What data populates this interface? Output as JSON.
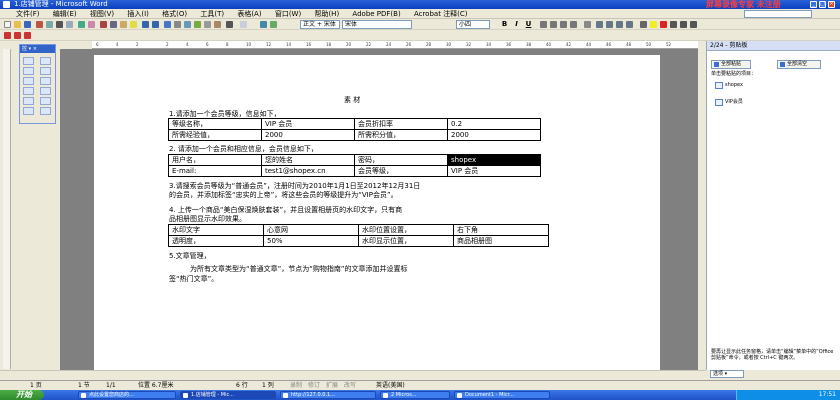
{
  "window": {
    "title": "1.店铺管理 - Microsoft Word",
    "watermark": "屏幕录像专家 未注册"
  },
  "menu": [
    "文件(F)",
    "编辑(E)",
    "视图(V)",
    "插入(I)",
    "格式(O)",
    "工具(T)",
    "表格(A)",
    "窗口(W)",
    "帮助(H)",
    "Adobe PDF(B)",
    "Acrobat 注释(C)"
  ],
  "toolbar": {
    "style": "正文 + 宋体",
    "font": "宋体",
    "size": "小四",
    "bold": "B",
    "italic": "I",
    "underline": "U"
  },
  "ruler_ticks": [
    "6",
    "4",
    "2",
    "2",
    "4",
    "6",
    "8",
    "10",
    "12",
    "14",
    "16",
    "18",
    "20",
    "22",
    "24",
    "26",
    "28",
    "30",
    "32",
    "34",
    "36",
    "38",
    "40",
    "42",
    "44",
    "46",
    "48",
    "50",
    "52"
  ],
  "palette": {
    "title": "控 ▾ ×"
  },
  "doc": {
    "title": "素 材",
    "item1": "1.请添加一个会员等级，信息如下，",
    "table1": [
      [
        "等级名称，",
        "VIP 会员",
        "会员折扣率",
        "0.2"
      ],
      [
        "所需经验值，",
        "2000",
        "所需积分值，",
        "2000"
      ]
    ],
    "item2": "2. 请添加一个会员和相应信息，会员信息如下，",
    "table2": [
      [
        "用户名，",
        "您的姓名",
        "密码，",
        "shopex"
      ],
      [
        "E-mail:",
        "test1@shopex.cn",
        "会员等级，",
        "VIP 会员"
      ]
    ],
    "item3a": "3.请搜索会员等级为“普通会员”，注册时间为2010年1月1日至2012年12月31日",
    "item3b": "的会员，并添加标签“忠实的上帝”，将这些会员的等级提升为“VIP会员”。",
    "item4a": "4. 上传一个商品“美白保湿焕肤套装”，并且设置相册页的水印文字，只有商",
    "item4b": "品相册图显示水印效果。",
    "table3": [
      [
        "水印文字",
        "心意网",
        "水印位置设置，",
        "右下角"
      ],
      [
        "透明度，",
        "50%",
        "水印显示位置，",
        "商品相册图"
      ]
    ],
    "item5": "5.文章管理，",
    "item5a": "为所有文章类型为“普通文章”，节点为“购物指南”的文章添加并设置标",
    "item5b": "签“热门文章”。"
  },
  "taskpane": {
    "header": "2/24 - 剪贴板",
    "paste_all": "全部粘贴",
    "clear_all": "全部清空",
    "hint": "单击要粘贴的项目：",
    "items": [
      "shopex",
      "VIP会员"
    ],
    "footer": "要再让显示此任务窗格，请单击“编辑”菜单中的“Office 剪贴板”命令，或者按 Ctrl+C 键两次。",
    "options": "选项 ▾"
  },
  "status": {
    "page": "1 页",
    "section": "1 节",
    "pages": "1/1",
    "position": "位置 6.7厘米",
    "line": "6 行",
    "column": "1 列",
    "rec": "录制",
    "trk": "修订",
    "ext": "扩展",
    "ovr": "改写",
    "lang": "英语(美国)"
  },
  "taskbar": {
    "start": "开始",
    "tasks": [
      "点此设置您商店的...",
      "1.店铺管理 - Mic...",
      "http://127.0.0.1...",
      "2 Micros...",
      "Document1 - Micr..."
    ],
    "clock": "17:51"
  },
  "colors": {
    "title_bar": "#0a3fbf",
    "taskbar": "#1f52c8",
    "start": "#2e8a2c",
    "watermark": "#ff3c3c"
  }
}
